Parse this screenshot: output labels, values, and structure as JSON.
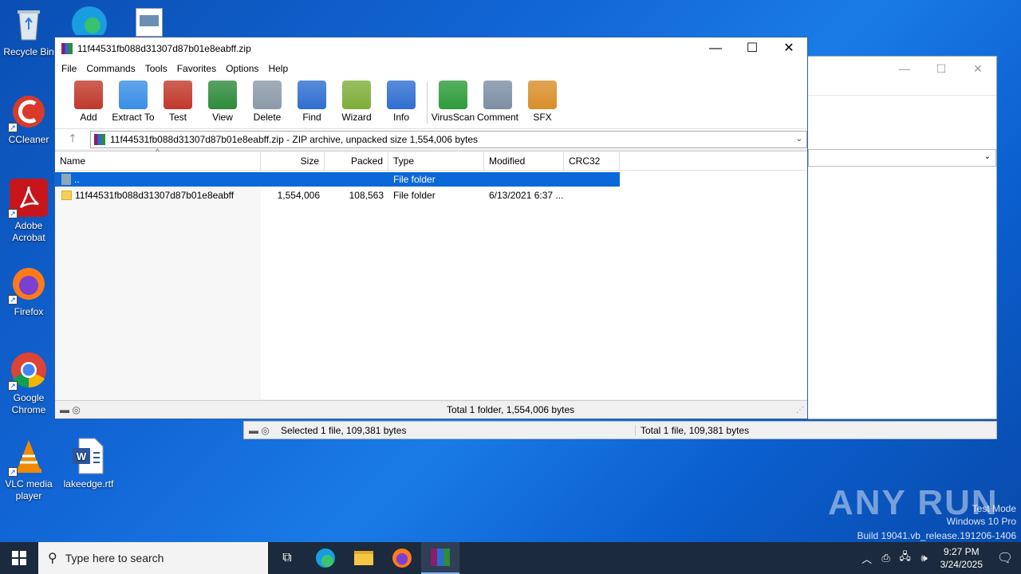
{
  "desktop": {
    "icons": [
      {
        "label": "Recycle Bin"
      },
      {
        "label": "CCleaner"
      },
      {
        "label": "Adobe Acrobat"
      },
      {
        "label": "Firefox"
      },
      {
        "label": "Google Chrome"
      },
      {
        "label": "VLC media player"
      },
      {
        "label": "lakeedge.rtf"
      }
    ]
  },
  "winrar": {
    "title": "11f44531fb088d31307d87b01e8eabff.zip",
    "menu": [
      "File",
      "Commands",
      "Tools",
      "Favorites",
      "Options",
      "Help"
    ],
    "toolbar": [
      {
        "label": "Add",
        "icon": "add-archive-icon",
        "color": "#c0392b"
      },
      {
        "label": "Extract To",
        "icon": "extract-folder-icon",
        "color": "#3a8ee6"
      },
      {
        "label": "Test",
        "icon": "test-clipboard-icon",
        "color": "#c0392b"
      },
      {
        "label": "View",
        "icon": "view-book-icon",
        "color": "#2e8b3a"
      },
      {
        "label": "Delete",
        "icon": "trash-icon",
        "color": "#8a9aa8"
      },
      {
        "label": "Find",
        "icon": "magnifier-icon",
        "color": "#2f6fd0"
      },
      {
        "label": "Wizard",
        "icon": "magic-wand-icon",
        "color": "#7fae3a"
      },
      {
        "label": "Info",
        "icon": "info-icon",
        "color": "#2f6fd0"
      },
      {
        "label": "VirusScan",
        "icon": "virus-scan-icon",
        "color": "#2e9b3a"
      },
      {
        "label": "Comment",
        "icon": "comment-icon",
        "color": "#7d8fa3"
      },
      {
        "label": "SFX",
        "icon": "sfx-box-icon",
        "color": "#d98e2a"
      }
    ],
    "path": "11f44531fb088d31307d87b01e8eabff.zip - ZIP archive, unpacked size 1,554,006 bytes",
    "columns": [
      "Name",
      "Size",
      "Packed",
      "Type",
      "Modified",
      "CRC32"
    ],
    "rows": [
      {
        "name": "..",
        "size": "",
        "packed": "",
        "type": "File folder",
        "modified": "",
        "crc": ""
      },
      {
        "name": "11f44531fb088d31307d87b01e8eabff",
        "size": "1,554,006",
        "packed": "108,563",
        "type": "File folder",
        "modified": "6/13/2021 6:37 ...",
        "crc": ""
      }
    ],
    "status": "Total 1 folder, 1,554,006 bytes"
  },
  "background_window": {
    "status_left": "Selected 1 file, 109,381 bytes",
    "status_right": "Total 1 file, 109,381 bytes"
  },
  "watermark": {
    "brand": "ANY RUN",
    "line1": "Test Mode",
    "line2": "Windows 10 Pro",
    "line3": "Build 19041.vb_release.191206-1406"
  },
  "taskbar": {
    "search_placeholder": "Type here to search",
    "time": "9:27 PM",
    "date": "3/24/2025"
  }
}
